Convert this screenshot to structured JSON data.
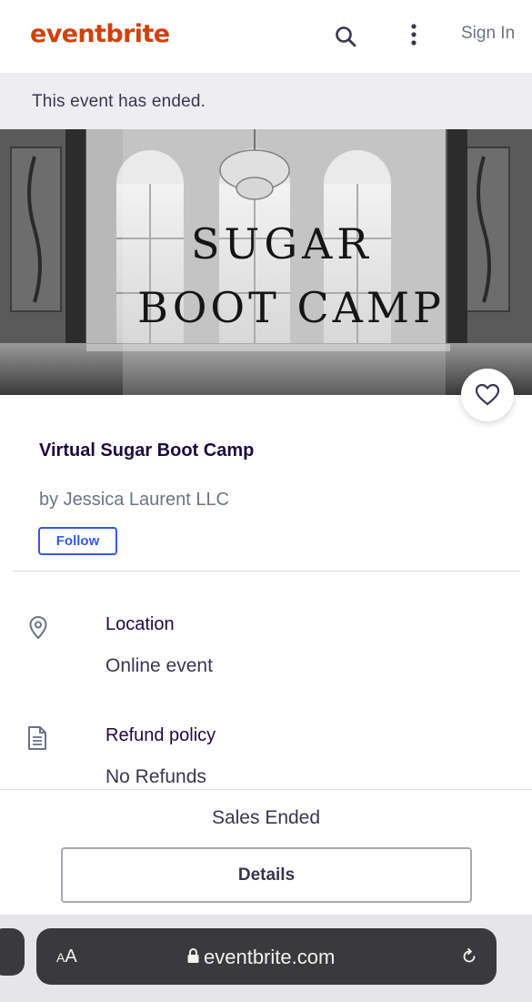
{
  "header": {
    "logo": "eventbrite",
    "search_icon": "search-icon",
    "more_icon": "more-vertical-icon",
    "signin_label": "Sign In"
  },
  "banner": {
    "text": "This event has ended."
  },
  "hero": {
    "line1": "SUGAR",
    "line2": "BOOT CAMP",
    "like_icon": "heart-icon"
  },
  "event": {
    "title": "Virtual Sugar Boot Camp",
    "organizer": "by Jessica Laurent LLC",
    "follow_label": "Follow"
  },
  "details": {
    "location_icon": "location-pin-icon",
    "location_label": "Location",
    "location_value": "Online event",
    "refund_icon": "document-icon",
    "refund_label": "Refund policy",
    "refund_value": "No Refunds"
  },
  "footer": {
    "status": "Sales Ended",
    "details_label": "Details"
  },
  "browser": {
    "text_size_label_small": "A",
    "text_size_label_large": "A",
    "url": "eventbrite.com",
    "reload_icon": "reload-icon"
  },
  "colors": {
    "brand": "#d1410c",
    "follow_blue": "#3659e3",
    "title": "#1e0a3c",
    "muted": "#6f7287"
  }
}
